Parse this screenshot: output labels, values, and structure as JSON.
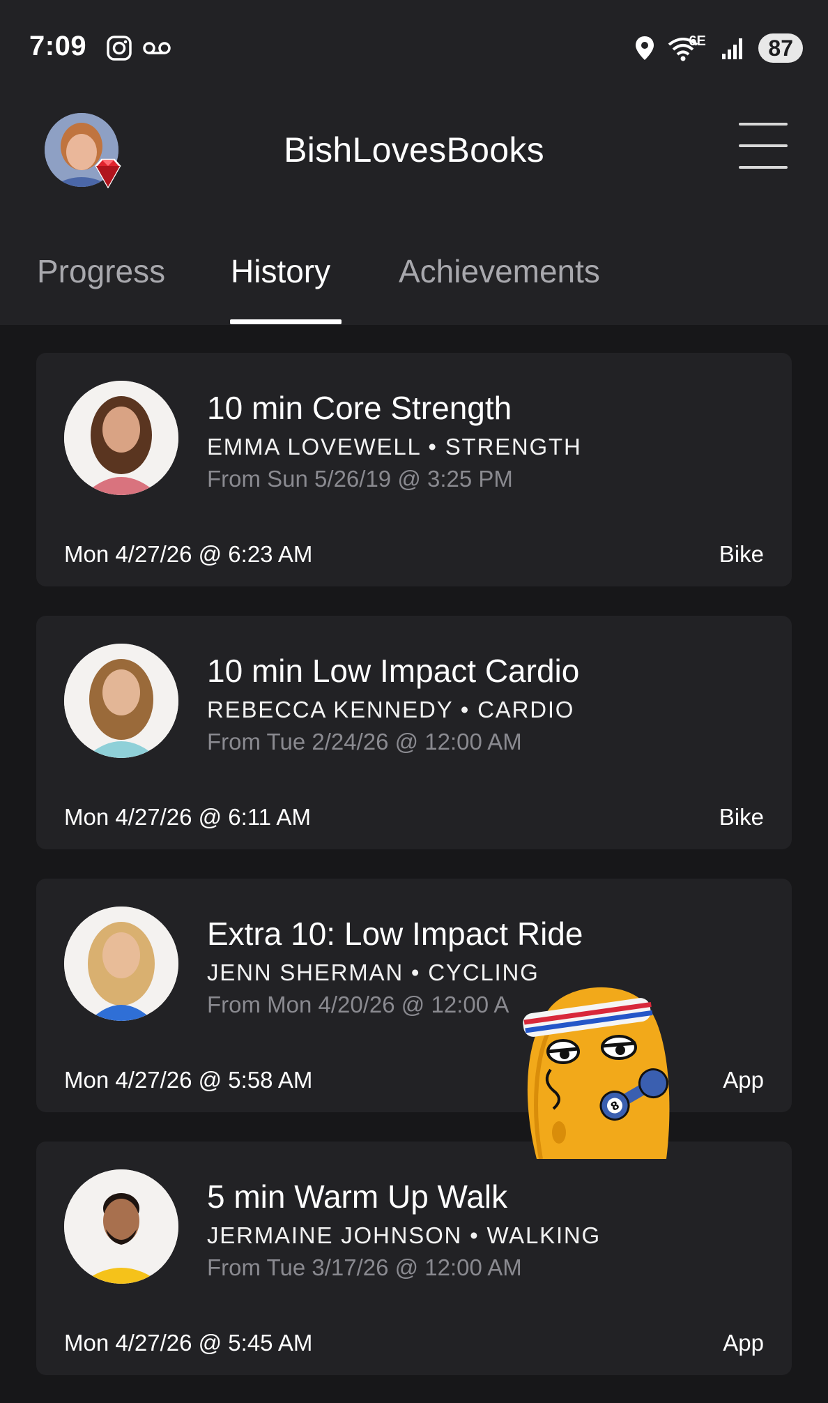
{
  "status_bar": {
    "time": "7:09",
    "network_label": "6E",
    "battery": "87",
    "icons": [
      "instagram-icon",
      "voicemail-icon",
      "location-icon",
      "wifi-icon",
      "signal-icon"
    ]
  },
  "header": {
    "title": "BishLovesBooks",
    "avatar_badge": "ruby-gem-icon",
    "menu_icon": "hamburger-menu-icon"
  },
  "tabs": [
    {
      "label": "Progress",
      "active": false
    },
    {
      "label": "History",
      "active": true
    },
    {
      "label": "Achievements",
      "active": false
    }
  ],
  "workouts": [
    {
      "title": "10 min Core Strength",
      "meta": "EMMA LOVEWELL • STRENGTH",
      "from": "From Sun 5/26/19 @ 3:25 PM",
      "date": "Mon 4/27/26 @ 6:23 AM",
      "device": "Bike",
      "colors": {
        "hair": "#5a3520",
        "shirt": "#d9737e",
        "skin": "#d9a384"
      }
    },
    {
      "title": "10 min Low Impact Cardio",
      "meta": "REBECCA KENNEDY • CARDIO",
      "from": "From Tue 2/24/26 @ 12:00 AM",
      "date": "Mon 4/27/26 @ 6:11 AM",
      "device": "Bike",
      "colors": {
        "hair": "#9a6a3a",
        "shirt": "#8fd0d8",
        "skin": "#e3b696"
      }
    },
    {
      "title": "Extra 10: Low Impact Ride",
      "meta": "JENN SHERMAN • CYCLING",
      "from": "From Mon 4/20/26 @ 12:00 A",
      "date": "Mon 4/27/26 @ 5:58 AM",
      "device": "App",
      "colors": {
        "hair": "#d9b070",
        "shirt": "#2f6fd6",
        "skin": "#e8bc98"
      }
    },
    {
      "title": "5 min Warm Up Walk",
      "meta": "JERMAINE JOHNSON • WALKING",
      "from": "From Tue 3/17/26 @ 12:00 AM",
      "date": "Mon 4/27/26 @ 5:45 AM",
      "device": "App",
      "colors": {
        "hair": "#1e1410",
        "shirt": "#f5c21a",
        "skin": "#a8704e"
      }
    }
  ],
  "sticker": {
    "name": "potato-mascot-with-dumbbell"
  }
}
